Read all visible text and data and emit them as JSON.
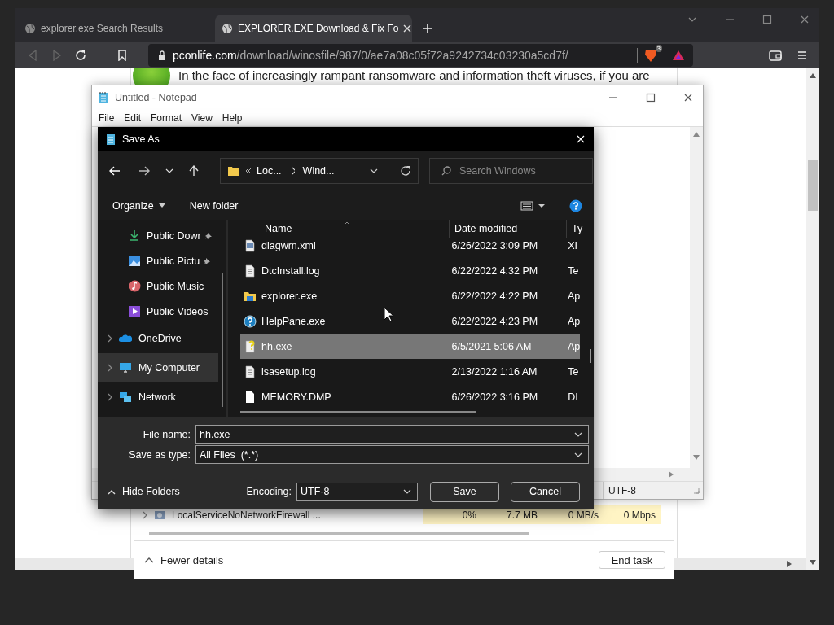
{
  "browser": {
    "tabs": [
      {
        "title": "explorer.exe Search Results",
        "selected": false
      },
      {
        "title": "EXPLORER.EXE Download & Fix Fo",
        "selected": true
      }
    ],
    "address": {
      "domain": "pconlife.com",
      "path": "/download/winosfile/987/0/ae7a08c05f72a9242734c03230a5cd7f/"
    },
    "shield_count": "3",
    "page_text": "In the face of increasingly rampant ransomware and information theft viruses, if you are"
  },
  "task_manager": {
    "row": {
      "name": "LocalServiceNoNetworkFirewall ...",
      "cells": [
        "0%",
        "7.7 MB",
        "0 MB/s",
        "0 Mbps"
      ]
    },
    "fewer_details": "Fewer details",
    "end_task": "End task"
  },
  "notepad": {
    "title": "Untitled - Notepad",
    "menu": [
      "File",
      "Edit",
      "Format",
      "View",
      "Help"
    ],
    "status_encoding": "UTF-8"
  },
  "save_dialog": {
    "title": "Save As",
    "breadcrumb": [
      "Loc...",
      "Wind..."
    ],
    "search_placeholder": "Search Windows",
    "organize": "Organize",
    "new_folder": "New folder",
    "nav": [
      {
        "label": "Public Dowr",
        "kind": "child",
        "pinned": true,
        "selected": false
      },
      {
        "label": "Public Pictu",
        "kind": "child",
        "pinned": true,
        "selected": false
      },
      {
        "label": "Public Music",
        "kind": "child",
        "pinned": false,
        "selected": false
      },
      {
        "label": "Public Videos",
        "kind": "child",
        "pinned": false,
        "selected": false
      },
      {
        "label": "OneDrive",
        "kind": "root",
        "pinned": false,
        "selected": false
      },
      {
        "label": "My Computer",
        "kind": "root",
        "pinned": false,
        "selected": true
      },
      {
        "label": "Network",
        "kind": "root",
        "pinned": false,
        "selected": false
      }
    ],
    "columns": [
      "Name",
      "Date modified",
      "Ty"
    ],
    "files": [
      {
        "name": "diagwrn.xml",
        "date": "6/26/2022 3:09 PM",
        "type": "XI",
        "kind": "xml",
        "selected": false
      },
      {
        "name": "DtcInstall.log",
        "date": "6/22/2022 4:32 PM",
        "type": "Te",
        "kind": "text",
        "selected": false
      },
      {
        "name": "explorer.exe",
        "date": "6/22/2022 4:22 PM",
        "type": "Ap",
        "kind": "folder",
        "selected": false
      },
      {
        "name": "HelpPane.exe",
        "date": "6/22/2022 4:23 PM",
        "type": "Ap",
        "kind": "help",
        "selected": false
      },
      {
        "name": "hh.exe",
        "date": "6/5/2021 5:06 AM",
        "type": "Ap",
        "kind": "helpfile",
        "selected": true
      },
      {
        "name": "lsasetup.log",
        "date": "2/13/2022 1:16 AM",
        "type": "Te",
        "kind": "text",
        "selected": false
      },
      {
        "name": "MEMORY.DMP",
        "date": "6/26/2022 3:16 PM",
        "type": "DI",
        "kind": "blank",
        "selected": false
      }
    ],
    "file_name_label": "File name:",
    "file_name": "hh.exe",
    "type_label": "Save as type:",
    "save_as_type": "All Files  (*.*)",
    "hide_folders": "Hide Folders",
    "encoding_label": "Encoding:",
    "encoding": "UTF-8",
    "save": "Save",
    "cancel": "Cancel"
  }
}
